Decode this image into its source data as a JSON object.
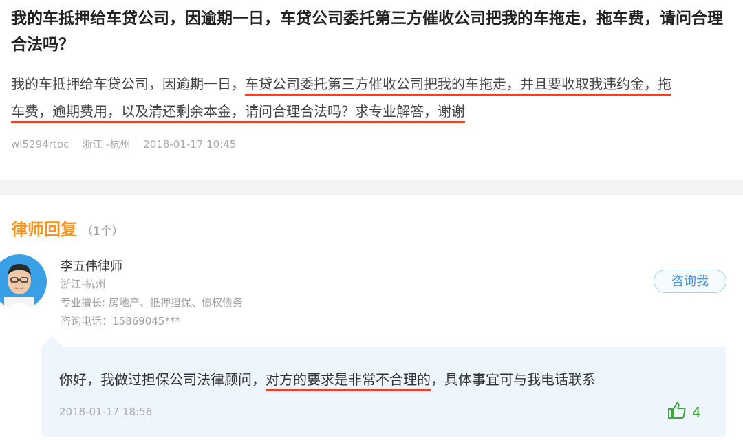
{
  "question": {
    "title": "我的车抵押给车贷公司，因逾期一日，车贷公司委托第三方催收公司把我的车拖走，拖车费，请问合理合法吗？",
    "body_part1": "我的车抵押给车贷公司，因逾期一日，",
    "body_highlight1": "车贷公司委托第三方催收公司把我的车拖走，并且要收取我违约金，拖",
    "body_highlight2": "车费，逾期费用，以及清还剩余本金，请问合理合法吗？求专业解答，谢谢",
    "author": "wl5294rtbc",
    "location": "浙江 -杭州",
    "time": "2018-01-17 10:45"
  },
  "answers_section": {
    "title": "律师回复",
    "count": "（1个）"
  },
  "lawyer": {
    "name": "李五伟律师",
    "location": "浙江-杭州",
    "specialty": "专业擅长: 房地产、抵押担保、债权债务",
    "phone": "咨询电话：15869045***",
    "consult_button": "咨询我"
  },
  "answer": {
    "text_part1": "你好，我做过担保公司法律顾问，",
    "text_highlight": "对方的要求是非常不合理的",
    "text_part2": "，具体事宜可与我电话联系",
    "time": "2018-01-17 18:56",
    "likes": "4"
  },
  "colors": {
    "accent_orange": "#f7931e",
    "highlight_red": "#e8442b",
    "link_blue": "#3d8fdc",
    "like_green": "#3aa83a"
  }
}
